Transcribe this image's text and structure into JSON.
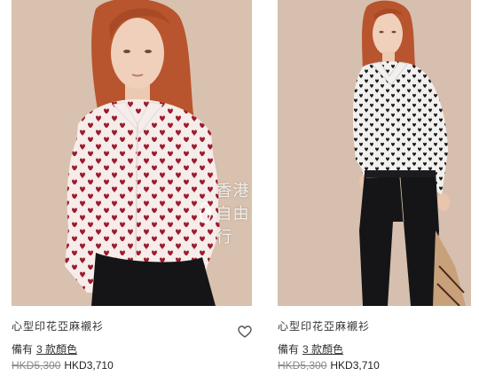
{
  "watermark": "香港自由行",
  "products": [
    {
      "name": "心型印花亞麻襯衫",
      "colors_prefix": "備有",
      "colors_link": "3 款顏色",
      "old_price": "HKD5,300",
      "new_price": "HKD3,710",
      "favorite_icon": "heart-outline-icon"
    },
    {
      "name": "心型印花亞麻襯衫",
      "colors_prefix": "備有",
      "colors_link": "3 款顏色",
      "old_price": "HKD5,300",
      "new_price": "HKD3,710"
    }
  ],
  "colors": {
    "background_left": "#d8c1ae",
    "background_right": "#d6bfae",
    "shirt": "#f6ecea",
    "hearts": "#9b1b2c",
    "hair": "#b8552e",
    "jeans": "#151518"
  }
}
